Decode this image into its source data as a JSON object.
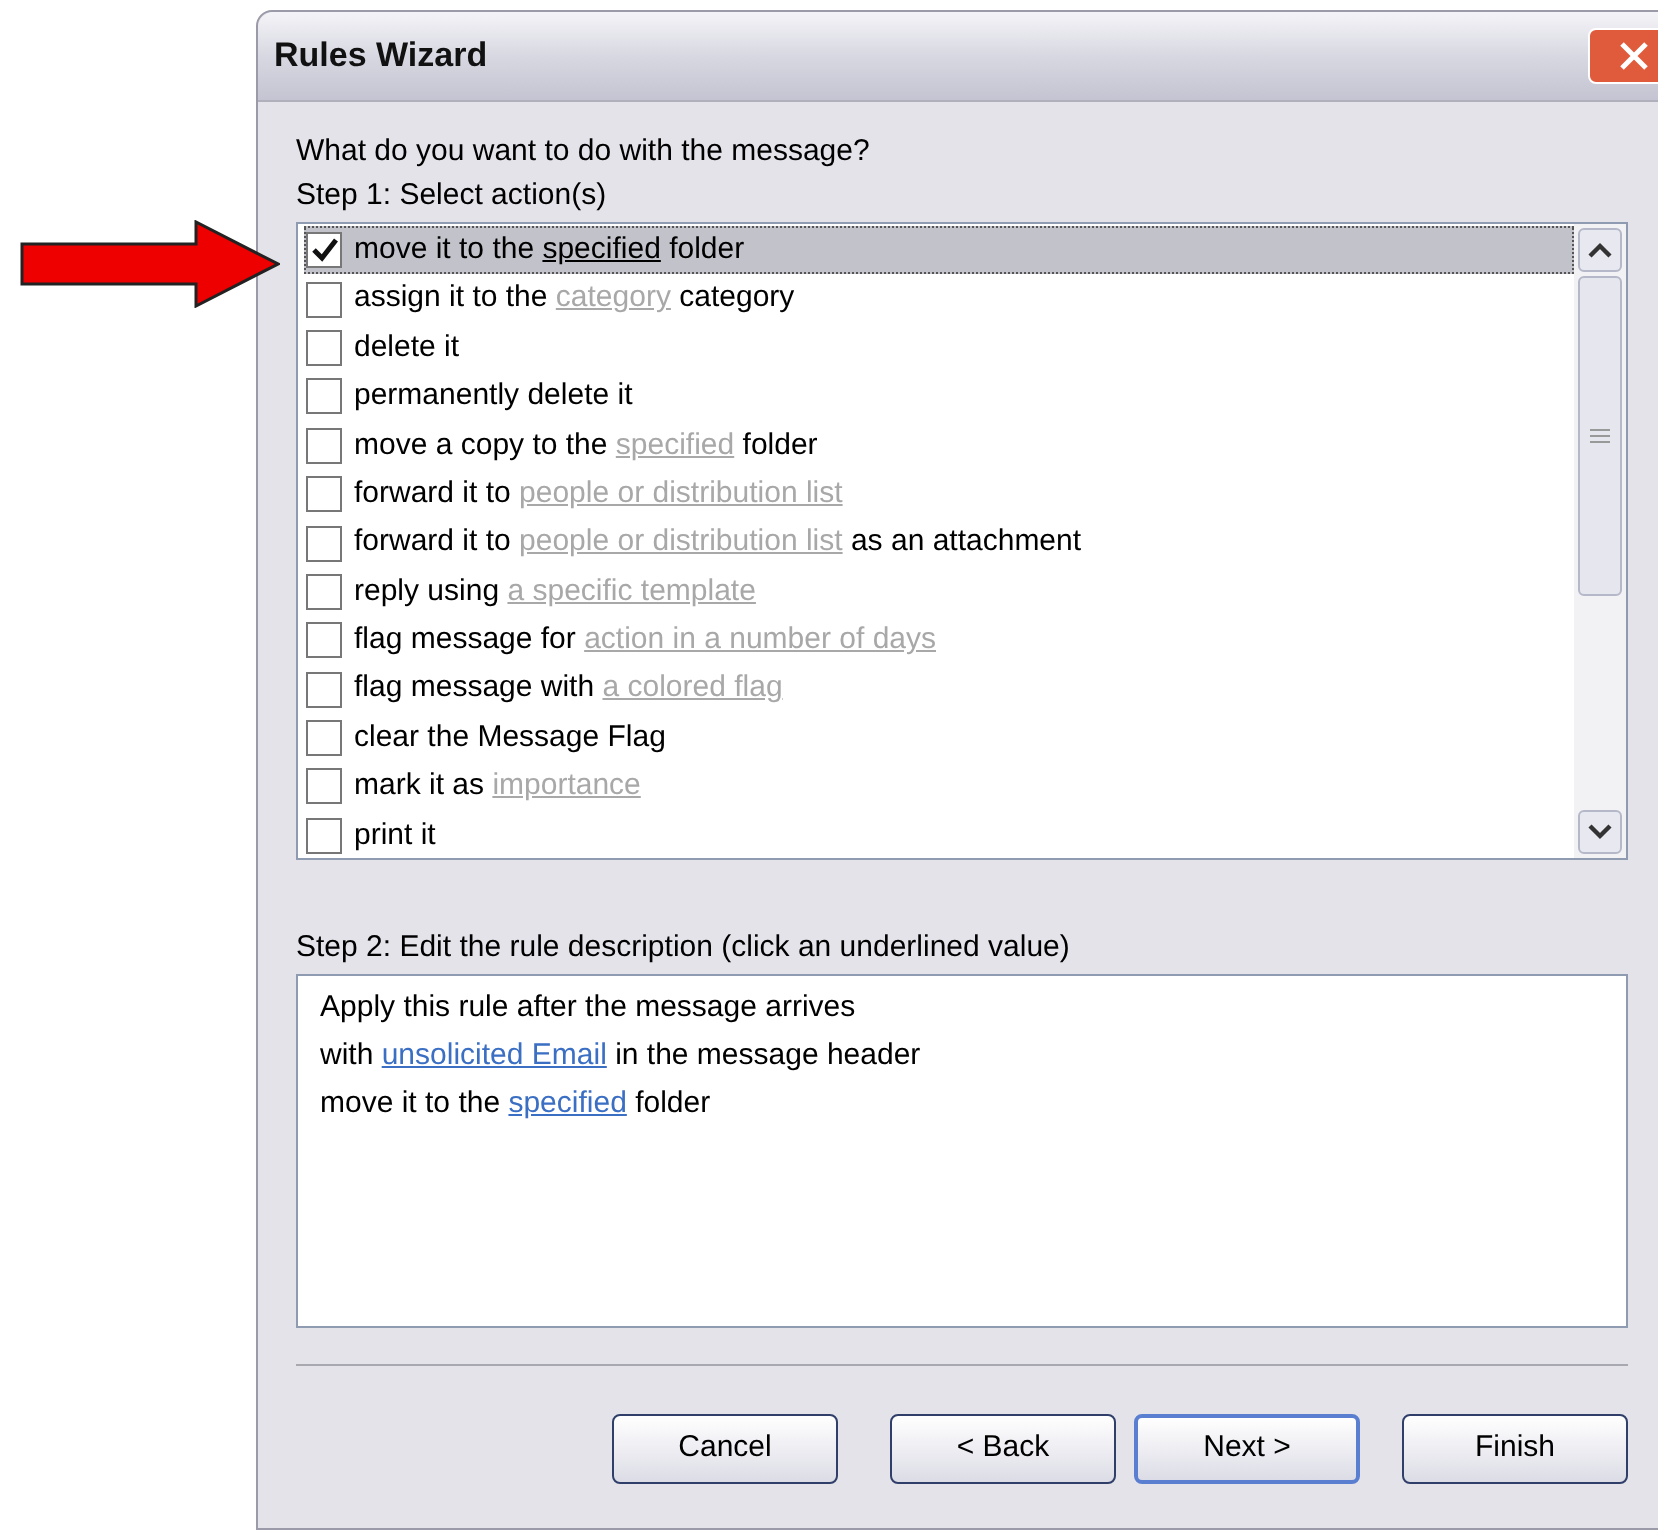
{
  "window": {
    "title": "Rules Wizard"
  },
  "prompt": "What do you want to do with the message?",
  "step1": {
    "label": "Step 1: Select action(s)",
    "actions": [
      {
        "checked": true,
        "selected": true,
        "parts": [
          {
            "kind": "plain",
            "text": "move it to the "
          },
          {
            "kind": "value",
            "text": "specified"
          },
          {
            "kind": "plain",
            "text": " folder"
          }
        ]
      },
      {
        "checked": false,
        "selected": false,
        "parts": [
          {
            "kind": "plain",
            "text": "assign it to the "
          },
          {
            "kind": "value",
            "text": "category"
          },
          {
            "kind": "plain",
            "text": " category"
          }
        ]
      },
      {
        "checked": false,
        "selected": false,
        "parts": [
          {
            "kind": "plain",
            "text": "delete it"
          }
        ]
      },
      {
        "checked": false,
        "selected": false,
        "parts": [
          {
            "kind": "plain",
            "text": "permanently delete it"
          }
        ]
      },
      {
        "checked": false,
        "selected": false,
        "parts": [
          {
            "kind": "plain",
            "text": "move a copy to the "
          },
          {
            "kind": "value",
            "text": "specified"
          },
          {
            "kind": "plain",
            "text": " folder"
          }
        ]
      },
      {
        "checked": false,
        "selected": false,
        "parts": [
          {
            "kind": "plain",
            "text": "forward it to "
          },
          {
            "kind": "value",
            "text": "people or distribution list"
          }
        ]
      },
      {
        "checked": false,
        "selected": false,
        "parts": [
          {
            "kind": "plain",
            "text": "forward it to "
          },
          {
            "kind": "value",
            "text": "people or distribution list"
          },
          {
            "kind": "plain",
            "text": " as an attachment"
          }
        ]
      },
      {
        "checked": false,
        "selected": false,
        "parts": [
          {
            "kind": "plain",
            "text": "reply using "
          },
          {
            "kind": "value",
            "text": "a specific template"
          }
        ]
      },
      {
        "checked": false,
        "selected": false,
        "parts": [
          {
            "kind": "plain",
            "text": "flag message for "
          },
          {
            "kind": "value",
            "text": "action in a number of days"
          }
        ]
      },
      {
        "checked": false,
        "selected": false,
        "parts": [
          {
            "kind": "plain",
            "text": "flag message with "
          },
          {
            "kind": "value",
            "text": "a colored flag"
          }
        ]
      },
      {
        "checked": false,
        "selected": false,
        "parts": [
          {
            "kind": "plain",
            "text": "clear the Message Flag"
          }
        ]
      },
      {
        "checked": false,
        "selected": false,
        "parts": [
          {
            "kind": "plain",
            "text": "mark it as "
          },
          {
            "kind": "value",
            "text": "importance"
          }
        ]
      },
      {
        "checked": false,
        "selected": false,
        "parts": [
          {
            "kind": "plain",
            "text": "print it"
          }
        ]
      }
    ]
  },
  "step2": {
    "label": "Step 2: Edit the rule description (click an underlined value)",
    "lines": [
      [
        {
          "kind": "plain",
          "text": "Apply this rule after the message arrives"
        }
      ],
      [
        {
          "kind": "plain",
          "text": "with "
        },
        {
          "kind": "link",
          "text": "unsolicited Email"
        },
        {
          "kind": "plain",
          "text": " in the message header"
        }
      ],
      [
        {
          "kind": "plain",
          "text": "move it to the "
        },
        {
          "kind": "link",
          "text": "specified"
        },
        {
          "kind": "plain",
          "text": " folder"
        }
      ]
    ]
  },
  "buttons": [
    {
      "label": "Cancel",
      "default": false
    },
    {
      "label": "< Back",
      "default": false
    },
    {
      "label": "Next >",
      "default": true
    },
    {
      "label": "Finish",
      "default": false
    }
  ]
}
